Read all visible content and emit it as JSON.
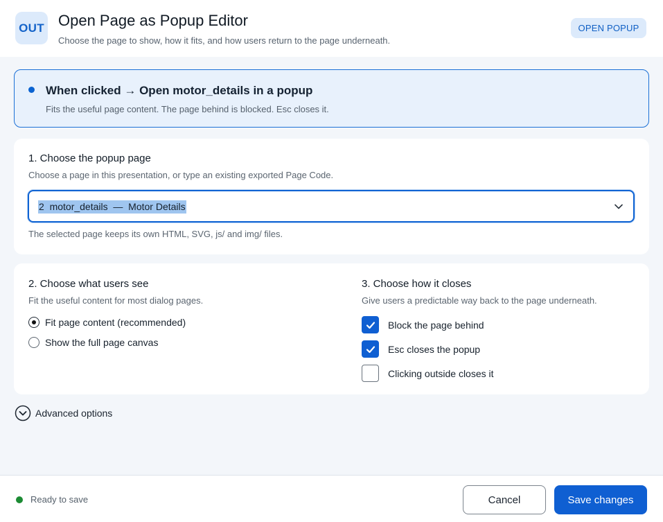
{
  "header": {
    "icon_text": "OUT",
    "title": "Open Page as Popup Editor",
    "subtitle": "Choose the page to show, how it fits, and how users return to the page underneath.",
    "badge": "OPEN POPUP"
  },
  "summary": {
    "title": "When clicked → Open motor_details in a popup",
    "subtitle": "Fits the useful page content. The page behind is blocked. Esc closes it."
  },
  "page_section": {
    "title": "1. Choose the popup page",
    "help": "Choose a page in this presentation, or type an existing exported Page Code.",
    "selected_value": "2  motor_details  —  Motor Details",
    "note": "The selected page keeps its own HTML, SVG, js/ and img/ files."
  },
  "view_section": {
    "title": "2. Choose what users see",
    "help": "Fit the useful content for most dialog pages.",
    "options": [
      {
        "label": "Fit page content (recommended)",
        "selected": true
      },
      {
        "label": "Show the full page canvas",
        "selected": false
      }
    ]
  },
  "close_section": {
    "title": "3. Choose how it closes",
    "help": "Give users a predictable way back to the page underneath.",
    "options": [
      {
        "label": "Block the page behind",
        "checked": true
      },
      {
        "label": "Esc closes the popup",
        "checked": true
      },
      {
        "label": "Clicking outside closes it",
        "checked": false
      }
    ]
  },
  "advanced": {
    "label": "Advanced options",
    "icon": "chevron-down-circle-icon"
  },
  "footer": {
    "status": "Ready to save",
    "status_color": "#1c8b34",
    "cancel_label": "Cancel",
    "save_label": "Save changes"
  },
  "colors": {
    "accent": "#0f5fd2",
    "summary_bg": "#e8f1fc",
    "page_bg": "#f3f6fa"
  }
}
